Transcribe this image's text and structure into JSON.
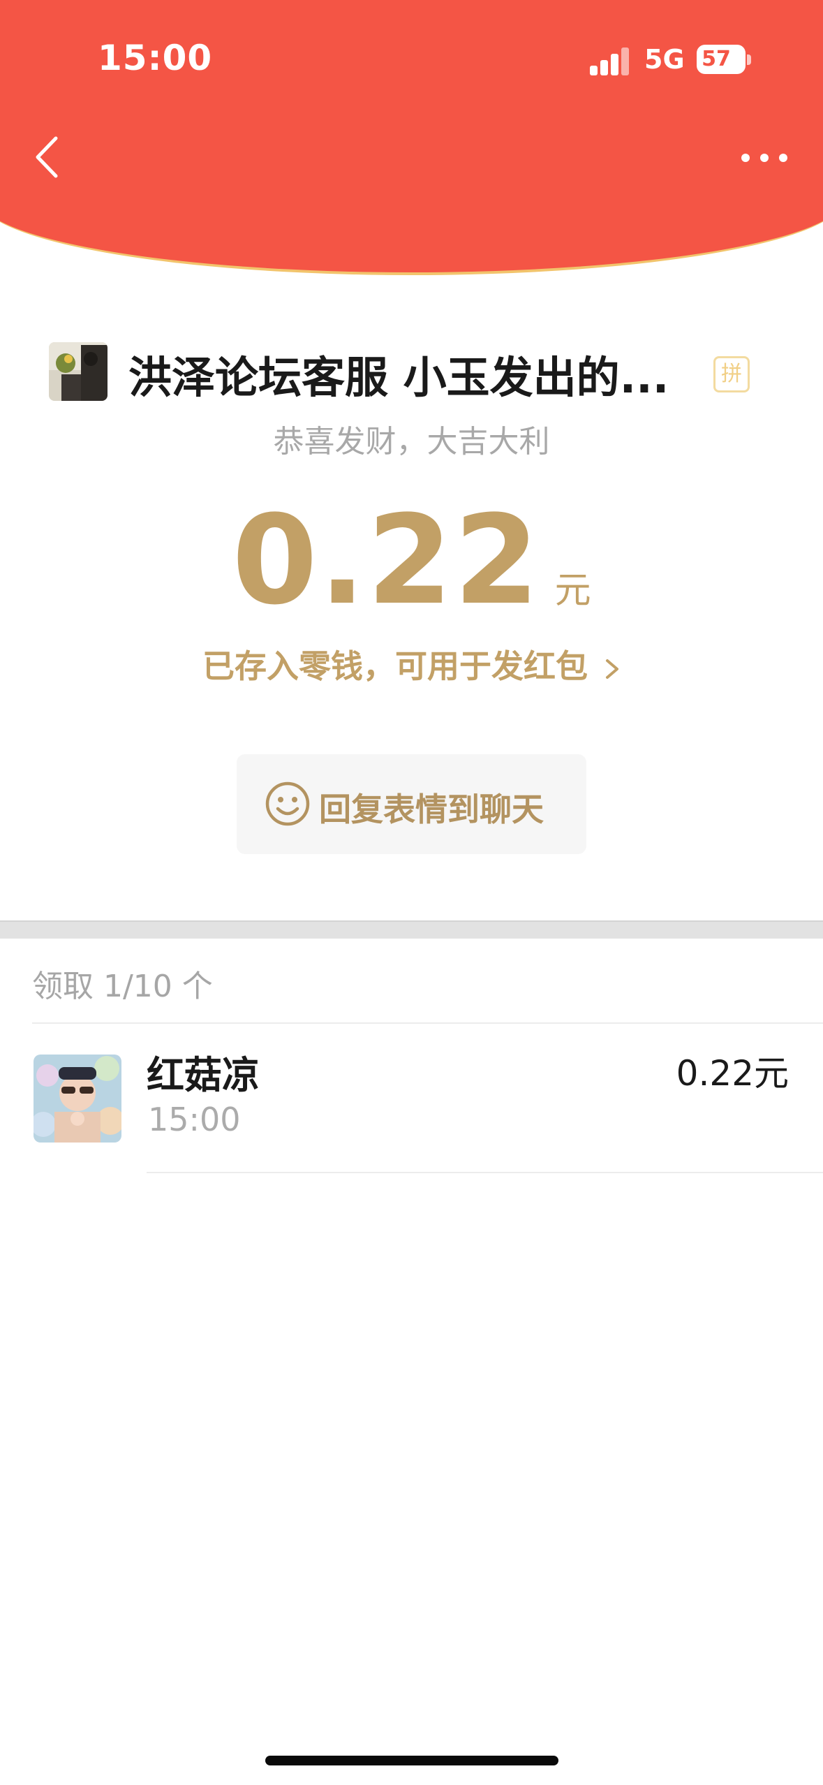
{
  "status_bar": {
    "time": "15:00",
    "network": "5G",
    "battery": "57"
  },
  "nav": {
    "back_icon": "chevron-left-icon",
    "more_icon": "more-dots-icon"
  },
  "envelope": {
    "title": "洪泽论坛客服 小玉发出的...",
    "type_badge": "拼",
    "wish": "恭喜发财，大吉大利",
    "amount": "0.22",
    "currency": "元",
    "deposit_note": "已存入零钱，可用于发红包"
  },
  "reply_button": {
    "icon": "smiley-icon",
    "label": "回复表情到聊天"
  },
  "records": {
    "summary": "领取 1/10 个",
    "items": [
      {
        "name": "红菇凉",
        "time": "15:00",
        "amount": "0.22元"
      }
    ]
  },
  "colors": {
    "header_red": "#f45545",
    "header_border": "#f2c46c",
    "gold": "#c2a066"
  }
}
